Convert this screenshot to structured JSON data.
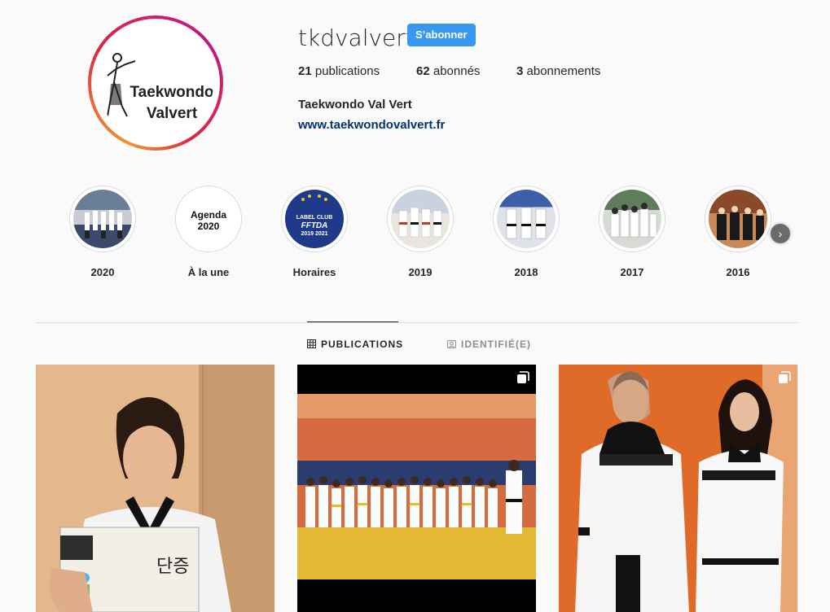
{
  "profile": {
    "username": "tkdvalvert",
    "follow_label": "S’abonner",
    "logo_line1": "Taekwondo",
    "logo_line2": "Valvert",
    "publications_count": "21",
    "publications_label": "publications",
    "followers_count": "62",
    "followers_label": "abonnés",
    "following_count": "3",
    "following_label": "abonnements",
    "full_name": "Taekwondo Val Vert",
    "website": "www.taekwondovalvert.fr"
  },
  "stories": [
    {
      "label": "2020"
    },
    {
      "label": "À la une",
      "cover_line1": "Agenda",
      "cover_line2": "2020"
    },
    {
      "label": "Horaires",
      "cover_line1": "LABEL CLUB",
      "cover_line2": "FFTDA",
      "cover_line3": "2019  2021"
    },
    {
      "label": "2019"
    },
    {
      "label": "2018"
    },
    {
      "label": "2017"
    },
    {
      "label": "2016"
    }
  ],
  "tabs": {
    "publications": "PUBLICATIONS",
    "tagged": "IDENTIFIÉ(E)"
  },
  "colors": {
    "accent": "#3897f0",
    "link": "#003569",
    "background": "#fafafa"
  }
}
